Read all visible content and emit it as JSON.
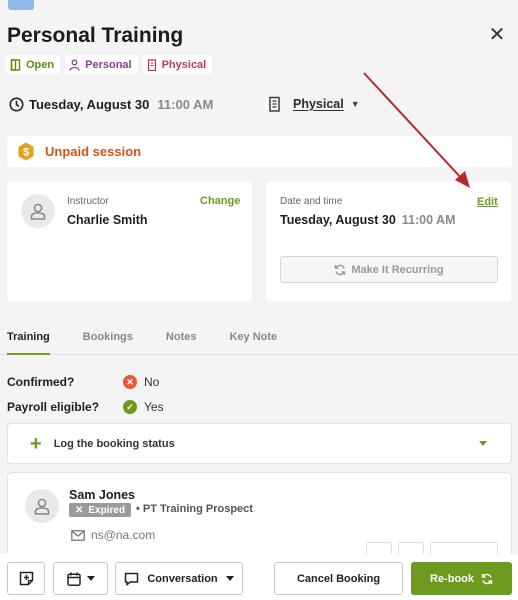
{
  "header": {
    "title": "Personal Training",
    "tags": [
      {
        "label": "Open",
        "icon": "door-icon",
        "color": "#5a8a10"
      },
      {
        "label": "Personal",
        "icon": "person-icon",
        "color": "#8a3d93"
      },
      {
        "label": "Physical",
        "icon": "building-icon",
        "color": "#c13962"
      }
    ]
  },
  "schedule": {
    "date": "Tuesday, August 30",
    "time": "11:00 AM",
    "location": "Physical"
  },
  "payment": {
    "status": "Unpaid session",
    "icon": "dollar-badge-icon"
  },
  "instructor_card": {
    "label": "Instructor",
    "name": "Charlie Smith",
    "action": "Change"
  },
  "datetime_card": {
    "label": "Date and time",
    "date": "Tuesday, August 30",
    "time": "11:00 AM",
    "action": "Edit",
    "recurring_button": "Make It Recurring"
  },
  "tabs": [
    "Training",
    "Bookings",
    "Notes",
    "Key Note"
  ],
  "details": {
    "confirmed_label": "Confirmed?",
    "confirmed_value": "No",
    "payroll_label": "Payroll eligible?",
    "payroll_value": "Yes"
  },
  "log_status": {
    "label": "Log the booking status"
  },
  "client": {
    "name": "Sam Jones",
    "badge": "Expired",
    "type": "PT Training Prospect",
    "email": "ns@na.com"
  },
  "footer": {
    "conversation": "Conversation",
    "cancel": "Cancel Booking",
    "rebook": "Re-book"
  },
  "colors": {
    "accent": "#6e9a1e",
    "warning": "#d1531c",
    "annotation_arrow": "#b5292f"
  }
}
